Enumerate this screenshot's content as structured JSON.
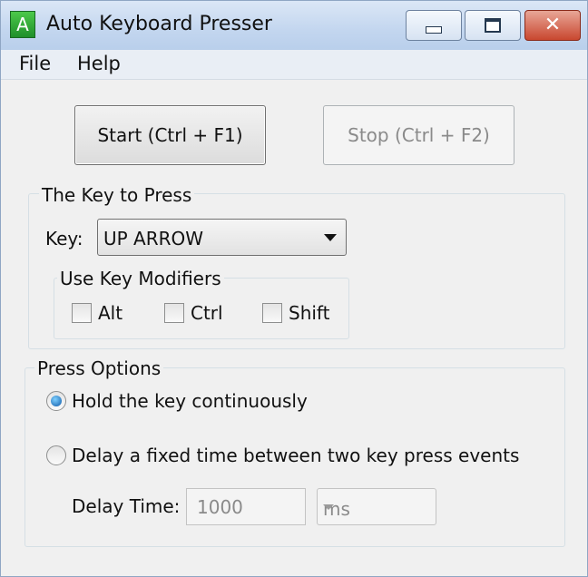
{
  "window": {
    "title": "Auto Keyboard Presser",
    "app_icon_letter": "A",
    "close_glyph": "✕"
  },
  "menu": [
    "File",
    "Help"
  ],
  "buttons": {
    "start": "Start (Ctrl + F1)",
    "stop": "Stop (Ctrl + F2)"
  },
  "key_group": {
    "legend": "The Key to Press",
    "key_label": "Key:",
    "key_value": "UP ARROW",
    "modifiers_legend": "Use Key Modifiers",
    "modifiers": [
      {
        "label": "Alt",
        "checked": false
      },
      {
        "label": "Ctrl",
        "checked": false
      },
      {
        "label": "Shift",
        "checked": false
      }
    ]
  },
  "press_options": {
    "legend": "Press Options",
    "option_hold": "Hold the key continuously",
    "option_delay": "Delay a fixed time between two key press events",
    "selected": "hold",
    "delay_label": "Delay Time:",
    "delay_value": "1000",
    "delay_unit": "ms"
  }
}
